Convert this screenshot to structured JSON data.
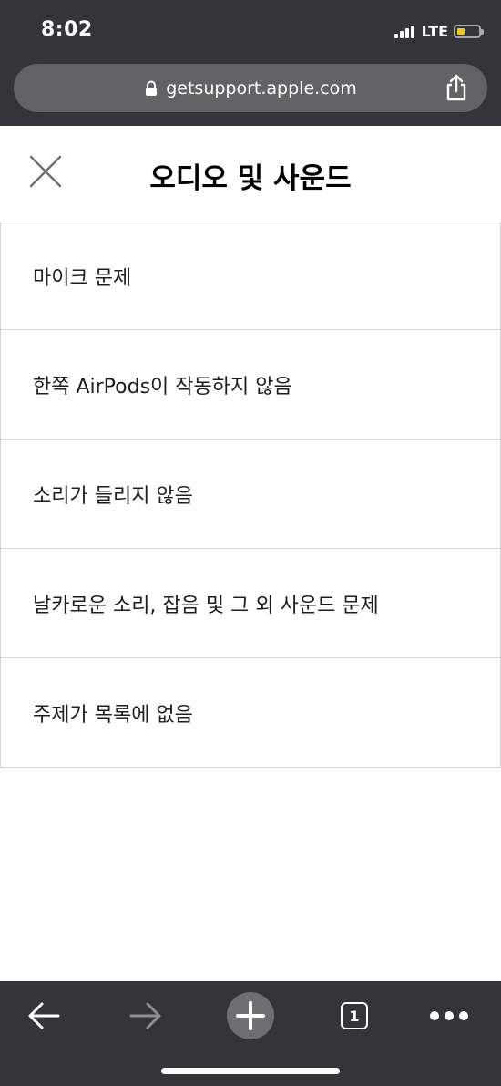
{
  "status_bar": {
    "time": "8:02",
    "network": "LTE",
    "battery_color": "#f5c518"
  },
  "browser": {
    "url": "getsupport.apple.com",
    "icons": [
      "lock-icon",
      "share-icon"
    ]
  },
  "header": {
    "title": "오디오 및 사운드",
    "close_icon": "close-icon"
  },
  "topics": [
    "마이크 문제",
    "한쪽 AirPods이 작동하지 않음",
    "소리가 들리지 않음",
    "날카로운 소리, 잡음 및 그 외 사운드 문제",
    "주제가 목록에 없음"
  ],
  "toolbar": {
    "tab_count": "1",
    "icons": [
      "back-arrow-icon",
      "forward-arrow-icon",
      "new-tab-icon",
      "tabs-icon",
      "more-icon"
    ]
  },
  "colors": {
    "chrome_bg": "#353539",
    "url_bar_bg": "#636366",
    "border": "#d2d2d7"
  }
}
